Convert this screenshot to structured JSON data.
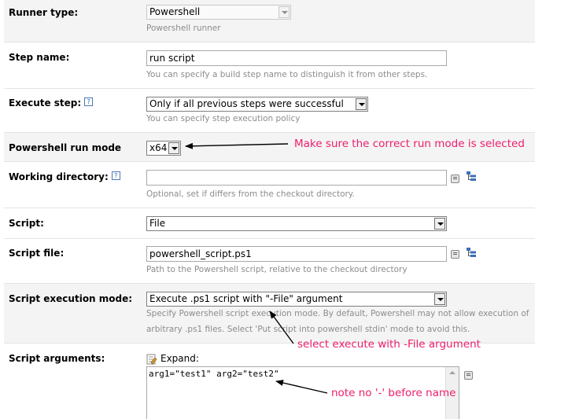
{
  "runner_type": {
    "label": "Runner type:",
    "value": "Powershell",
    "note": "Powershell runner"
  },
  "step_name": {
    "label": "Step name:",
    "value": "run script",
    "note": "You can specify a build step name to distinguish it from other steps."
  },
  "execute_step": {
    "label": "Execute step:",
    "help": "?",
    "value": "Only if all previous steps were successful",
    "note": "You can specify step execution policy"
  },
  "run_mode": {
    "label": "Powershell run mode",
    "value": "x64"
  },
  "working_directory": {
    "label": "Working directory:",
    "help": "?",
    "value": "",
    "note": "Optional, set if differs from the checkout directory."
  },
  "script": {
    "label": "Script:",
    "value": "File"
  },
  "script_file": {
    "label": "Script file:",
    "value": "powershell_script.ps1",
    "note": "Path to the Powershell script, relative to the checkout directory"
  },
  "script_execution_mode": {
    "label": "Script execution mode:",
    "value": "Execute .ps1 script with \"-File\" argument",
    "note_line1": "Specify Powershell script execution mode. By default, Powershell may not allow execution of",
    "note_line2": "arbitrary .ps1 files. Select 'Put script into powershell stdin' mode to avoid this."
  },
  "script_arguments": {
    "label": "Script arguments:",
    "expand": "Expand:",
    "value": "arg1=\"test1\" arg2=\"test2\""
  },
  "annotations": {
    "run_mode": "Make sure the correct run mode is selected",
    "file_argument": "select execute with -File argument",
    "no_dash": "note no '-' before name"
  },
  "colors": {
    "annotation": "#ee1d6b",
    "note_text": "#8c8c8c"
  }
}
